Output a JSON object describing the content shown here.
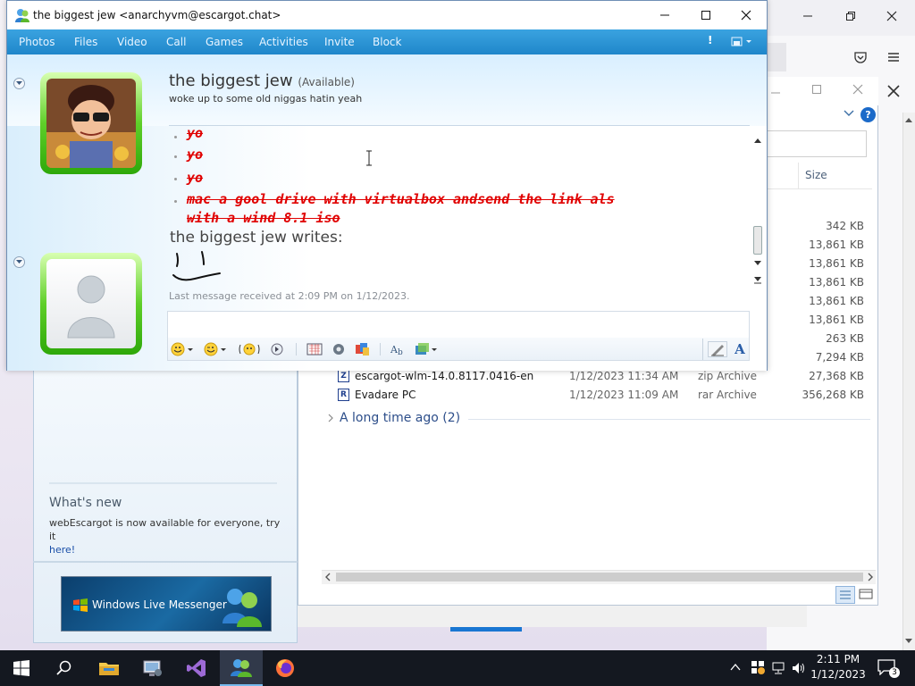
{
  "chat": {
    "title": "the biggest jew <anarchyvm@escargot.chat>",
    "menu": [
      "Photos",
      "Files",
      "Video",
      "Call",
      "Games",
      "Activities",
      "Invite",
      "Block"
    ],
    "contact_name": "the biggest jew",
    "contact_status": "(Available)",
    "personal_message": "woke up to some old niggas hatin yeah",
    "messages": [
      "yo",
      "yo",
      "yo",
      "mac a gool drive with virtualbox andsend the link als",
      "with a wind 8.1 iso"
    ],
    "writes_header": "the biggest jew writes:",
    "last_received": "Last message received at 2:09 PM on 1/12/2023."
  },
  "explorer": {
    "size_header": "Size",
    "sizes": [
      "342 KB",
      "13,861 KB",
      "13,861 KB",
      "13,861 KB",
      "13,861 KB",
      "13,861 KB",
      "263 KB",
      "7,294 KB"
    ],
    "rows": [
      {
        "name": "escargot-wlm-14.0.8117.0416-en",
        "date": "1/12/2023 11:34 AM",
        "type": "zip Archive",
        "size": "27,368 KB",
        "icon": "Z"
      },
      {
        "name": "Evadare PC",
        "date": "1/12/2023 11:09 AM",
        "type": "rar Archive",
        "size": "356,268 KB",
        "icon": "R"
      }
    ],
    "group_label": "A long time ago (2)"
  },
  "contact_list": {
    "whats_new_title": "What's new",
    "whats_new_text": "webEscargot is now available for everyone, try it",
    "whats_new_link": "here!",
    "ad_label": "Windows Live Messenger"
  },
  "taskbar": {
    "time": "2:11 PM",
    "date": "1/12/2023",
    "notification_count": "3"
  },
  "colors": {
    "menu_bar": "#1f86ca",
    "message_red": "#e00000",
    "taskbar": "#141820"
  }
}
